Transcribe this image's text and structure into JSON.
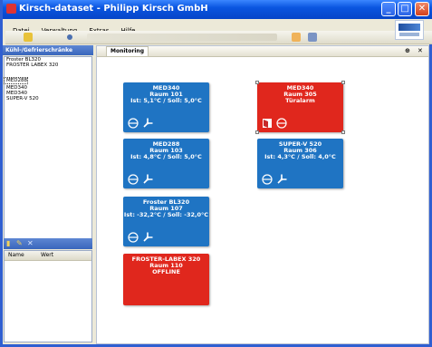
{
  "window": {
    "title": "Kirsch-dataset - Philipp Kirsch GmbH"
  },
  "menu": [
    {
      "label": "Datei"
    },
    {
      "label": "Verwaltung"
    },
    {
      "label": "Extras"
    },
    {
      "label": "Hilfe"
    }
  ],
  "left_panel": {
    "title": "Kühl-/Gefrierschränke",
    "devices": [
      {
        "label": "Froster BL320"
      },
      {
        "label": "FROSTER LABEX 320"
      },
      {
        "label": "MED288"
      },
      {
        "label": "MED340"
      },
      {
        "label": "MED340"
      },
      {
        "label": "SUPER-V 520"
      }
    ],
    "property_columns": [
      "Name",
      "Wert"
    ]
  },
  "main": {
    "tab": "Monitoring",
    "pin_glyph": "⊕",
    "close_glyph": "✕"
  },
  "cards": [
    {
      "lines": [
        "MED340",
        "Raum 101",
        "Ist: 5,1°C / Soll: 5,0°C"
      ],
      "color": "#1f74c3",
      "status": "normal"
    },
    {
      "lines": [
        "MED340",
        "Raum 305",
        "Türalarm"
      ],
      "color": "#e0271d",
      "status": "alarm"
    },
    {
      "lines": [
        "MED288",
        "Raum 103",
        "Ist: 4,8°C / Soll: 5,0°C"
      ],
      "color": "#1f74c3",
      "status": "normal"
    },
    {
      "lines": [
        "SUPER-V 520",
        "Raum 306",
        "Ist: 4,3°C / Soll: 4,0°C"
      ],
      "color": "#1f74c3",
      "status": "normal"
    },
    {
      "lines": [
        "Froster BL320",
        "Raum 107",
        "Ist: -32,2°C / Soll: -32,0°C"
      ],
      "color": "#1f74c3",
      "status": "normal"
    },
    {
      "lines": [
        "FROSTER-LABEX 320",
        "Raum 110",
        "OFFLINE"
      ],
      "color": "#e0271d",
      "status": "offline"
    }
  ]
}
